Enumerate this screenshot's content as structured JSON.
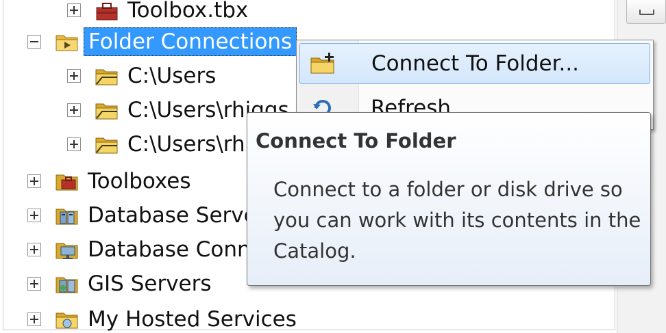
{
  "tree": {
    "items": [
      {
        "label": "Toolbox.tbx",
        "icon": "toolbox-icon",
        "expander": "plus"
      },
      {
        "label": "Folder Connections",
        "icon": "folder-connections-icon",
        "expander": "minus",
        "selected": true
      },
      {
        "label": "C:\\Users",
        "icon": "folder-icon",
        "expander": "plus"
      },
      {
        "label": "C:\\Users\\rhiggs",
        "icon": "folder-icon",
        "expander": "plus"
      },
      {
        "label": "C:\\Users\\rhiggs",
        "icon": "folder-icon",
        "expander": "plus"
      },
      {
        "label": "Toolboxes",
        "icon": "toolboxes-icon",
        "expander": "plus"
      },
      {
        "label": "Database Servers",
        "icon": "database-servers-icon",
        "expander": "plus"
      },
      {
        "label": "Database Connections",
        "icon": "database-connections-icon",
        "expander": "plus"
      },
      {
        "label": "GIS Servers",
        "icon": "gis-servers-icon",
        "expander": "plus"
      },
      {
        "label": "My Hosted Services",
        "icon": "hosted-services-icon",
        "expander": "plus"
      }
    ]
  },
  "context_menu": {
    "items": [
      {
        "label": "Connect To Folder...",
        "icon": "connect-folder-icon",
        "highlighted": true
      },
      {
        "label": "Refresh",
        "icon": "refresh-icon",
        "highlighted": false
      }
    ]
  },
  "tooltip": {
    "title": "Connect To Folder",
    "body": "Connect to a folder or disk drive so you can work with its contents in the Catalog."
  },
  "colors": {
    "selection": "#3399ff",
    "menu_highlight": "#d4e7fb",
    "folder_yellow": "#f2cf5b"
  }
}
